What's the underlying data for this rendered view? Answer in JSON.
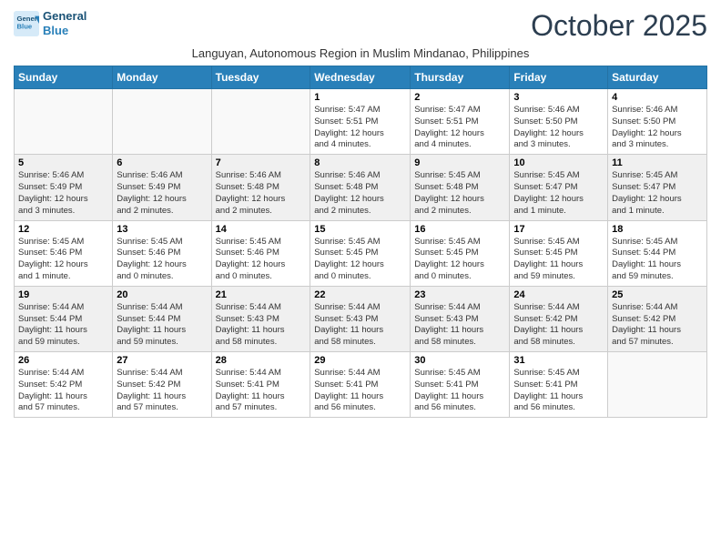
{
  "header": {
    "logo_line1": "General",
    "logo_line2": "Blue",
    "title": "October 2025",
    "subtitle": "Languyan, Autonomous Region in Muslim Mindanao, Philippines"
  },
  "days_of_week": [
    "Sunday",
    "Monday",
    "Tuesday",
    "Wednesday",
    "Thursday",
    "Friday",
    "Saturday"
  ],
  "weeks": [
    [
      {
        "day": "",
        "info": ""
      },
      {
        "day": "",
        "info": ""
      },
      {
        "day": "",
        "info": ""
      },
      {
        "day": "1",
        "info": "Sunrise: 5:47 AM\nSunset: 5:51 PM\nDaylight: 12 hours\nand 4 minutes."
      },
      {
        "day": "2",
        "info": "Sunrise: 5:47 AM\nSunset: 5:51 PM\nDaylight: 12 hours\nand 4 minutes."
      },
      {
        "day": "3",
        "info": "Sunrise: 5:46 AM\nSunset: 5:50 PM\nDaylight: 12 hours\nand 3 minutes."
      },
      {
        "day": "4",
        "info": "Sunrise: 5:46 AM\nSunset: 5:50 PM\nDaylight: 12 hours\nand 3 minutes."
      }
    ],
    [
      {
        "day": "5",
        "info": "Sunrise: 5:46 AM\nSunset: 5:49 PM\nDaylight: 12 hours\nand 3 minutes."
      },
      {
        "day": "6",
        "info": "Sunrise: 5:46 AM\nSunset: 5:49 PM\nDaylight: 12 hours\nand 2 minutes."
      },
      {
        "day": "7",
        "info": "Sunrise: 5:46 AM\nSunset: 5:48 PM\nDaylight: 12 hours\nand 2 minutes."
      },
      {
        "day": "8",
        "info": "Sunrise: 5:46 AM\nSunset: 5:48 PM\nDaylight: 12 hours\nand 2 minutes."
      },
      {
        "day": "9",
        "info": "Sunrise: 5:45 AM\nSunset: 5:48 PM\nDaylight: 12 hours\nand 2 minutes."
      },
      {
        "day": "10",
        "info": "Sunrise: 5:45 AM\nSunset: 5:47 PM\nDaylight: 12 hours\nand 1 minute."
      },
      {
        "day": "11",
        "info": "Sunrise: 5:45 AM\nSunset: 5:47 PM\nDaylight: 12 hours\nand 1 minute."
      }
    ],
    [
      {
        "day": "12",
        "info": "Sunrise: 5:45 AM\nSunset: 5:46 PM\nDaylight: 12 hours\nand 1 minute."
      },
      {
        "day": "13",
        "info": "Sunrise: 5:45 AM\nSunset: 5:46 PM\nDaylight: 12 hours\nand 0 minutes."
      },
      {
        "day": "14",
        "info": "Sunrise: 5:45 AM\nSunset: 5:46 PM\nDaylight: 12 hours\nand 0 minutes."
      },
      {
        "day": "15",
        "info": "Sunrise: 5:45 AM\nSunset: 5:45 PM\nDaylight: 12 hours\nand 0 minutes."
      },
      {
        "day": "16",
        "info": "Sunrise: 5:45 AM\nSunset: 5:45 PM\nDaylight: 12 hours\nand 0 minutes."
      },
      {
        "day": "17",
        "info": "Sunrise: 5:45 AM\nSunset: 5:45 PM\nDaylight: 11 hours\nand 59 minutes."
      },
      {
        "day": "18",
        "info": "Sunrise: 5:45 AM\nSunset: 5:44 PM\nDaylight: 11 hours\nand 59 minutes."
      }
    ],
    [
      {
        "day": "19",
        "info": "Sunrise: 5:44 AM\nSunset: 5:44 PM\nDaylight: 11 hours\nand 59 minutes."
      },
      {
        "day": "20",
        "info": "Sunrise: 5:44 AM\nSunset: 5:44 PM\nDaylight: 11 hours\nand 59 minutes."
      },
      {
        "day": "21",
        "info": "Sunrise: 5:44 AM\nSunset: 5:43 PM\nDaylight: 11 hours\nand 58 minutes."
      },
      {
        "day": "22",
        "info": "Sunrise: 5:44 AM\nSunset: 5:43 PM\nDaylight: 11 hours\nand 58 minutes."
      },
      {
        "day": "23",
        "info": "Sunrise: 5:44 AM\nSunset: 5:43 PM\nDaylight: 11 hours\nand 58 minutes."
      },
      {
        "day": "24",
        "info": "Sunrise: 5:44 AM\nSunset: 5:42 PM\nDaylight: 11 hours\nand 58 minutes."
      },
      {
        "day": "25",
        "info": "Sunrise: 5:44 AM\nSunset: 5:42 PM\nDaylight: 11 hours\nand 57 minutes."
      }
    ],
    [
      {
        "day": "26",
        "info": "Sunrise: 5:44 AM\nSunset: 5:42 PM\nDaylight: 11 hours\nand 57 minutes."
      },
      {
        "day": "27",
        "info": "Sunrise: 5:44 AM\nSunset: 5:42 PM\nDaylight: 11 hours\nand 57 minutes."
      },
      {
        "day": "28",
        "info": "Sunrise: 5:44 AM\nSunset: 5:41 PM\nDaylight: 11 hours\nand 57 minutes."
      },
      {
        "day": "29",
        "info": "Sunrise: 5:44 AM\nSunset: 5:41 PM\nDaylight: 11 hours\nand 56 minutes."
      },
      {
        "day": "30",
        "info": "Sunrise: 5:45 AM\nSunset: 5:41 PM\nDaylight: 11 hours\nand 56 minutes."
      },
      {
        "day": "31",
        "info": "Sunrise: 5:45 AM\nSunset: 5:41 PM\nDaylight: 11 hours\nand 56 minutes."
      },
      {
        "day": "",
        "info": ""
      }
    ]
  ]
}
